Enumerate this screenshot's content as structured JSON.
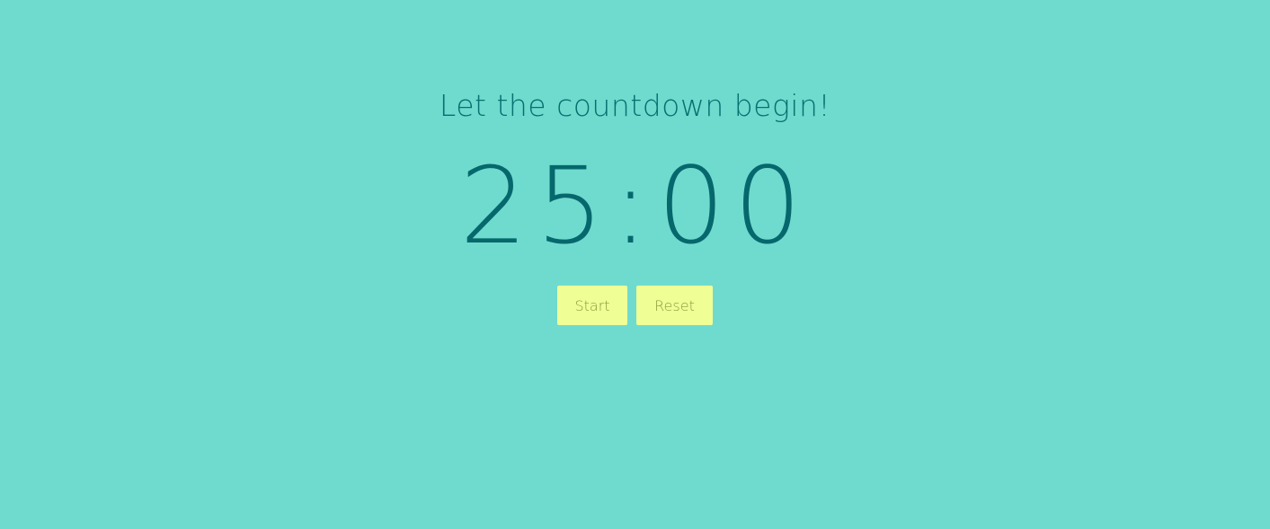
{
  "heading": "Let the countdown begin!",
  "timer": {
    "display": "25:00"
  },
  "controls": {
    "start_label": "Start",
    "reset_label": "Reset"
  },
  "colors": {
    "background": "#6fdbcf",
    "text": "#07706f",
    "button_background": "#efff96",
    "button_text": "#8c9a3c"
  }
}
